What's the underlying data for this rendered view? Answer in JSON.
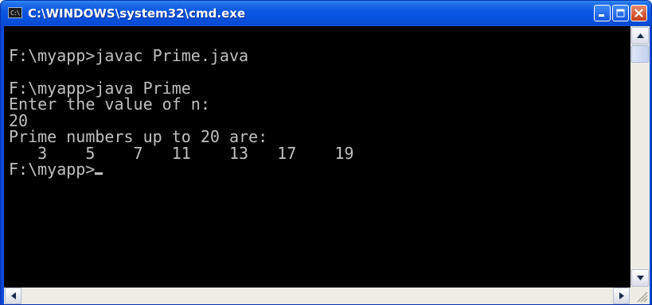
{
  "window": {
    "title": "C:\\WINDOWS\\system32\\cmd.exe",
    "icon_text": "C:\\",
    "controls": {
      "minimize": "minimize-icon",
      "maximize": "maximize-icon",
      "close": "close-icon"
    }
  },
  "console": {
    "lines": [
      "",
      "F:\\myapp>javac Prime.java",
      "",
      "F:\\myapp>java Prime",
      "Enter the value of n:",
      "20",
      "Prime numbers up to 20 are:",
      "   3    5    7   11    13   17    19",
      "F:\\myapp>"
    ]
  },
  "colors": {
    "console_background": "#000000",
    "console_text": "#c0c0c0",
    "titlebar": "#0a4bd0"
  }
}
